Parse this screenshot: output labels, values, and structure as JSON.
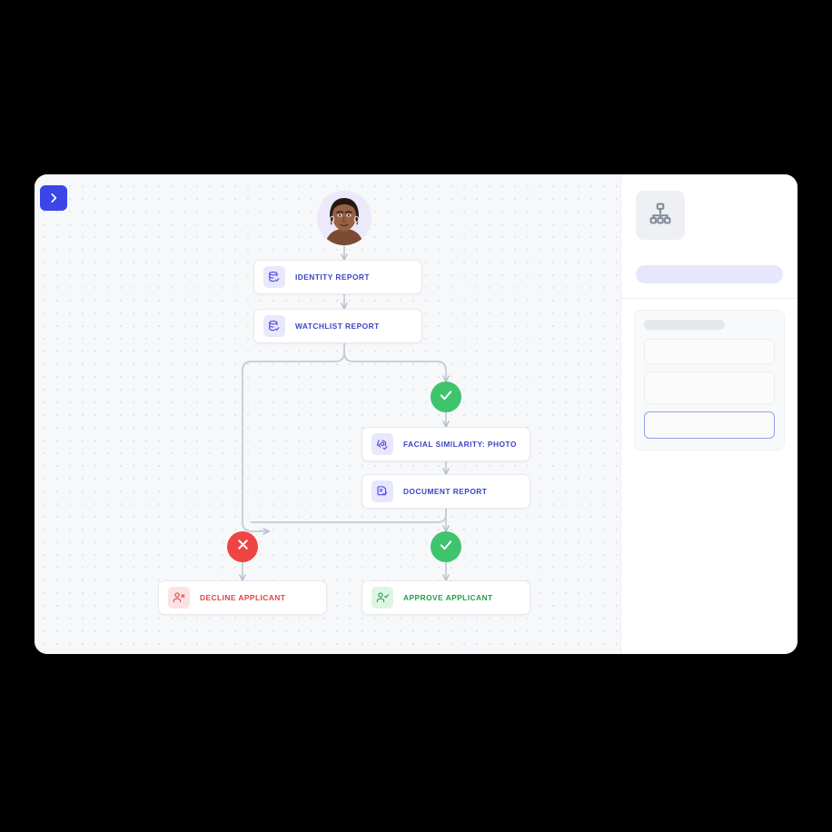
{
  "window": {
    "collapse_button": {
      "icon": "chevron-right-icon",
      "color": "#3b45e8"
    }
  },
  "canvas": {
    "name": "workflow-flowchart-canvas",
    "background": "#f7f8f9",
    "dot_grid": true
  },
  "flow": {
    "applicant": {
      "label": "applicant-avatar",
      "icon": "user-photo-avatar"
    },
    "nodes": [
      {
        "id": "identity-report",
        "label": "IDENTITY REPORT",
        "icon": "database-check-icon",
        "accent": "#3b45c4",
        "tint": "#e8e7fb"
      },
      {
        "id": "watchlist-report",
        "label": "WATCHLIST REPORT",
        "icon": "database-check-icon",
        "accent": "#3b45c4",
        "tint": "#e8e7fb"
      },
      {
        "id": "facial-similarity",
        "label": "FACIAL SIMILARITY: PHOTO",
        "icon": "face-scan-icon",
        "accent": "#3b45c4",
        "tint": "#e8e7fb"
      },
      {
        "id": "document-report",
        "label": "DOCUMENT REPORT",
        "icon": "document-check-icon",
        "accent": "#3b45c4",
        "tint": "#e8e7fb"
      },
      {
        "id": "decline-applicant",
        "label": "DECLINE APPLICANT",
        "icon": "user-remove-icon",
        "accent": "#e04343",
        "tint": "#fbe3e3"
      },
      {
        "id": "approve-applicant",
        "label": "APPROVE APPLICANT",
        "icon": "user-check-icon",
        "accent": "#22a04a",
        "tint": "#dff5e3"
      }
    ],
    "badges": [
      {
        "id": "pass-badge-watchlist",
        "icon": "check-circle-icon",
        "state": "pass",
        "color": "#3ec46d"
      },
      {
        "id": "fail-badge-final",
        "icon": "x-circle-icon",
        "state": "fail",
        "color": "#ef4444"
      },
      {
        "id": "pass-badge-final",
        "icon": "check-circle-icon",
        "state": "pass",
        "color": "#3ec46d"
      }
    ]
  },
  "side_panel": {
    "name": "properties-panel",
    "header_icon": "org-chart-icon",
    "skeleton": {
      "title_pill": true,
      "field_label": true,
      "fields": 2,
      "focused_field": true
    }
  },
  "cursor": {
    "icon": "hand-pointer-cursor"
  }
}
